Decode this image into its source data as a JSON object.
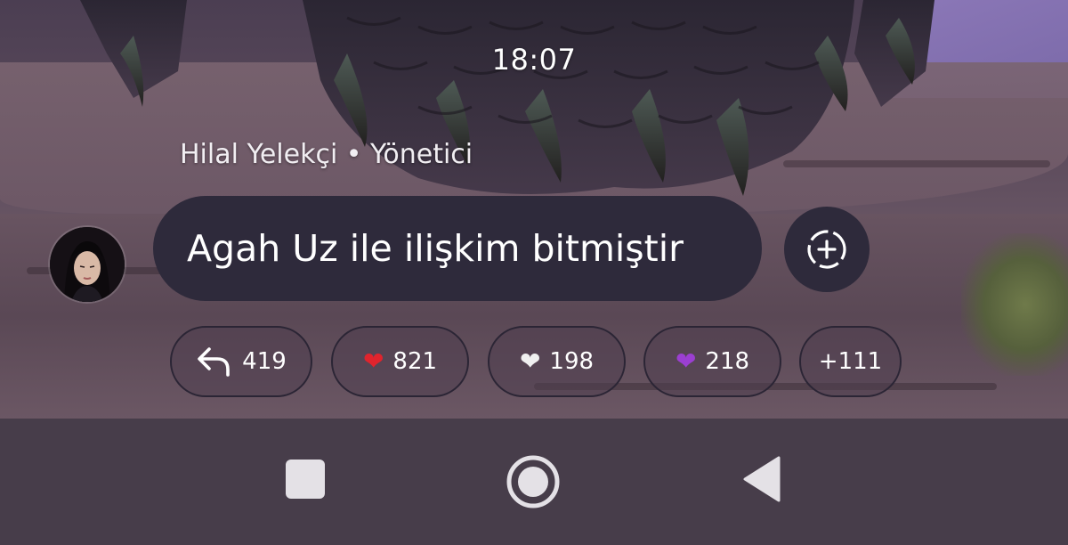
{
  "status_bar": {
    "time": "18:07"
  },
  "message": {
    "sender": "Hilal Yelekçi • Yönetici",
    "text": "Agah Uz ile ilişkim bitmiştir",
    "add_reaction_icon": "add-circle-dashed-icon"
  },
  "reactions": [
    {
      "icon": "reply-arrow-icon",
      "emoji": "",
      "count": "419"
    },
    {
      "icon": "red-heart-icon",
      "emoji": "❤️",
      "count": "821",
      "color": "#e0242d"
    },
    {
      "icon": "white-heart-icon",
      "emoji": "🤍",
      "count": "198",
      "color": "#f0f0f0"
    },
    {
      "icon": "purple-heart-icon",
      "emoji": "💜",
      "count": "218",
      "color": "#9b3fd1"
    },
    {
      "icon": "",
      "emoji": "",
      "count": "+111"
    }
  ],
  "nav_bar": {
    "recents_icon": "square-icon",
    "home_icon": "circle-home-icon",
    "back_icon": "triangle-back-icon"
  },
  "colors": {
    "bubble": "#2e2a3b",
    "nav_bar": "#473d4a",
    "text": "#ffffff"
  }
}
